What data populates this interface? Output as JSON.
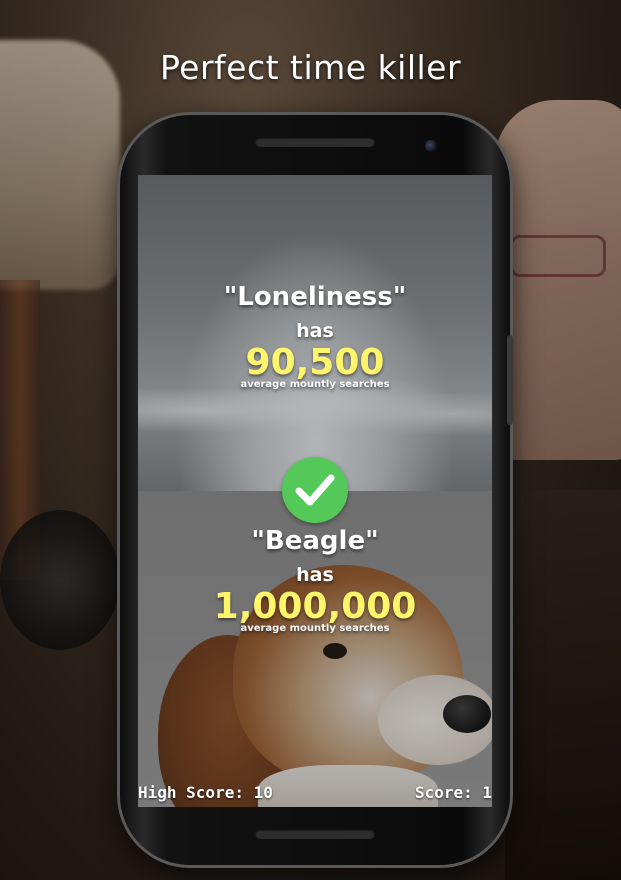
{
  "banner": {
    "headline": "Perfect time killer"
  },
  "game": {
    "first": {
      "keyword": "\"Loneliness\"",
      "connector": "has",
      "searches": "90,500",
      "caption": "average mountly searches"
    },
    "second": {
      "keyword": "\"Beagle\"",
      "connector": "has",
      "searches": "1,000,000",
      "caption": "average mountly searches"
    },
    "result_icon": "checkmark-icon",
    "footer": {
      "high_score": "High Score: 10",
      "score": "Score: 1"
    }
  },
  "colors": {
    "searches_highlight": "#fff56a",
    "correct_badge": "#55c85a"
  }
}
